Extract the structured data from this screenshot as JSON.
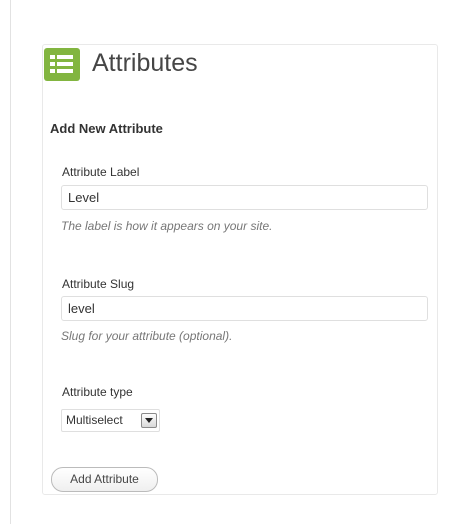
{
  "header": {
    "title": "Attributes",
    "icon": "attributes-list-icon",
    "icon_color": "#82b540"
  },
  "form": {
    "section_title": "Add New Attribute",
    "label_field": {
      "label": "Attribute Label",
      "value": "Level",
      "help": "The label is how it appears on your site."
    },
    "slug_field": {
      "label": "Attribute Slug",
      "value": "level",
      "help": "Slug for your attribute (optional)."
    },
    "type_field": {
      "label": "Attribute type",
      "selected": "Multiselect",
      "arrow_icon": "dropdown-arrow-icon"
    },
    "submit_label": "Add Attribute"
  }
}
